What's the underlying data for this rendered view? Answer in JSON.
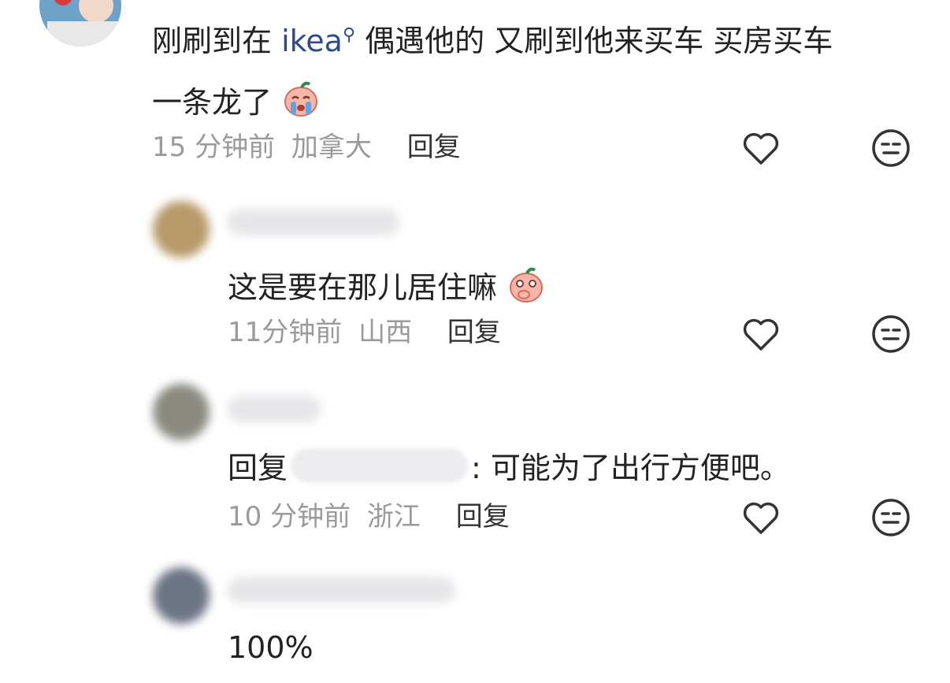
{
  "comments": [
    {
      "text_a": "刚刷到在 ",
      "link": "ikea",
      "text_b": " 偶遇他的 又刷到他来买车 买房买车",
      "text_line2": "一条龙了",
      "emoji": "crying-emoji",
      "time": "15 分钟前",
      "location": "加拿大",
      "reply_label": "回复"
    },
    {
      "text": "这是要在那儿居住嘛",
      "emoji": "thinking-emoji",
      "time": "11分钟前",
      "location": "山西",
      "reply_label": "回复"
    },
    {
      "reply_prefix": "回复",
      "text": ": 可能为了出行方便吧。",
      "time": "10 分钟前",
      "location": "浙江",
      "reply_label": "回复"
    },
    {
      "text": "100%"
    }
  ],
  "colors": {
    "meta": "#9a9a9a",
    "link": "#2f4a8a",
    "icon": "#333333"
  }
}
